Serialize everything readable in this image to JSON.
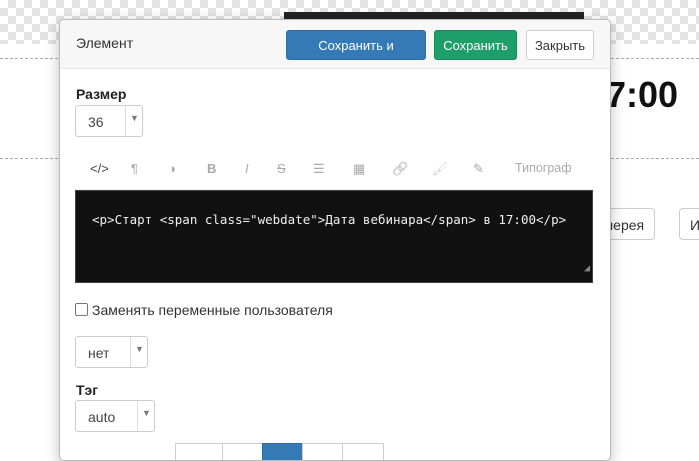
{
  "background": {
    "time_text": "7:00",
    "button_partial_1": "лерея",
    "button_partial_2": "И"
  },
  "modal": {
    "title": "Элемент",
    "buttons": {
      "save_close": "Сохранить и закрыть",
      "save": "Сохранить",
      "close": "Закрыть"
    },
    "size": {
      "label": "Размер",
      "value": "36"
    },
    "toolbar": {
      "code": "</>",
      "paragraph": "¶",
      "contrast": "◑",
      "bold": "B",
      "italic": "I",
      "strike": "S",
      "list": "☰",
      "table": "▦",
      "link": "🔗",
      "brush": "🖌",
      "pencil": "✎",
      "typograf": "Типограф"
    },
    "code_text": "<p>Старт <span class=\"webdate\">Дата вебинара</span> в 17:00</p>",
    "replace_vars_label": "Заменять переменные пользователя",
    "replace_vars_checked": false,
    "align_select": {
      "value": "нет"
    },
    "tag": {
      "label": "Тэг",
      "value": "auto"
    }
  }
}
